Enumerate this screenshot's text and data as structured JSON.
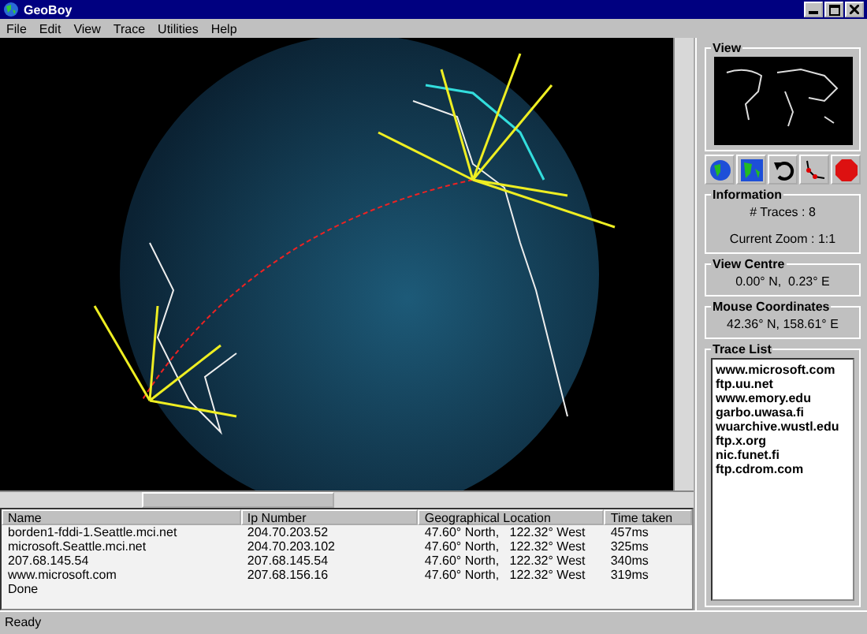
{
  "window": {
    "title": "GeoBoy"
  },
  "menu": [
    "File",
    "Edit",
    "View",
    "Trace",
    "Utilities",
    "Help"
  ],
  "table": {
    "columns": [
      "Name",
      "Ip Number",
      "Geographical Location",
      "Time taken"
    ],
    "rows": [
      [
        "borden1-fddi-1.Seattle.mci.net",
        "204.70.203.52",
        "47.60° North,   122.32° West",
        "457ms"
      ],
      [
        "microsoft.Seattle.mci.net",
        "204.70.203.102",
        "47.60° North,   122.32° West",
        "325ms"
      ],
      [
        "207.68.145.54",
        "207.68.145.54",
        "47.60° North,   122.32° West",
        "340ms"
      ],
      [
        "www.microsoft.com",
        "207.68.156.16",
        "47.60° North,   122.32° West",
        "319ms"
      ],
      [
        "Done"
      ]
    ]
  },
  "panel": {
    "view_title": "View",
    "information": {
      "title": "Information",
      "traces": "# Traces : 8",
      "zoom": "Current Zoom : 1:1"
    },
    "view_centre": {
      "title": "View Centre",
      "value": "0.00° N,  0.23° E"
    },
    "mouse": {
      "title": "Mouse Coordinates",
      "value": "42.36° N, 158.61° E"
    },
    "trace_list": {
      "title": "Trace List",
      "items": [
        "www.microsoft.com",
        "ftp.uu.net",
        "www.emory.edu",
        "garbo.uwasa.fi",
        "wuarchive.wustl.edu",
        "ftp.x.org",
        "nic.funet.fi",
        "ftp.cdrom.com"
      ]
    }
  },
  "status_bar": "Ready"
}
